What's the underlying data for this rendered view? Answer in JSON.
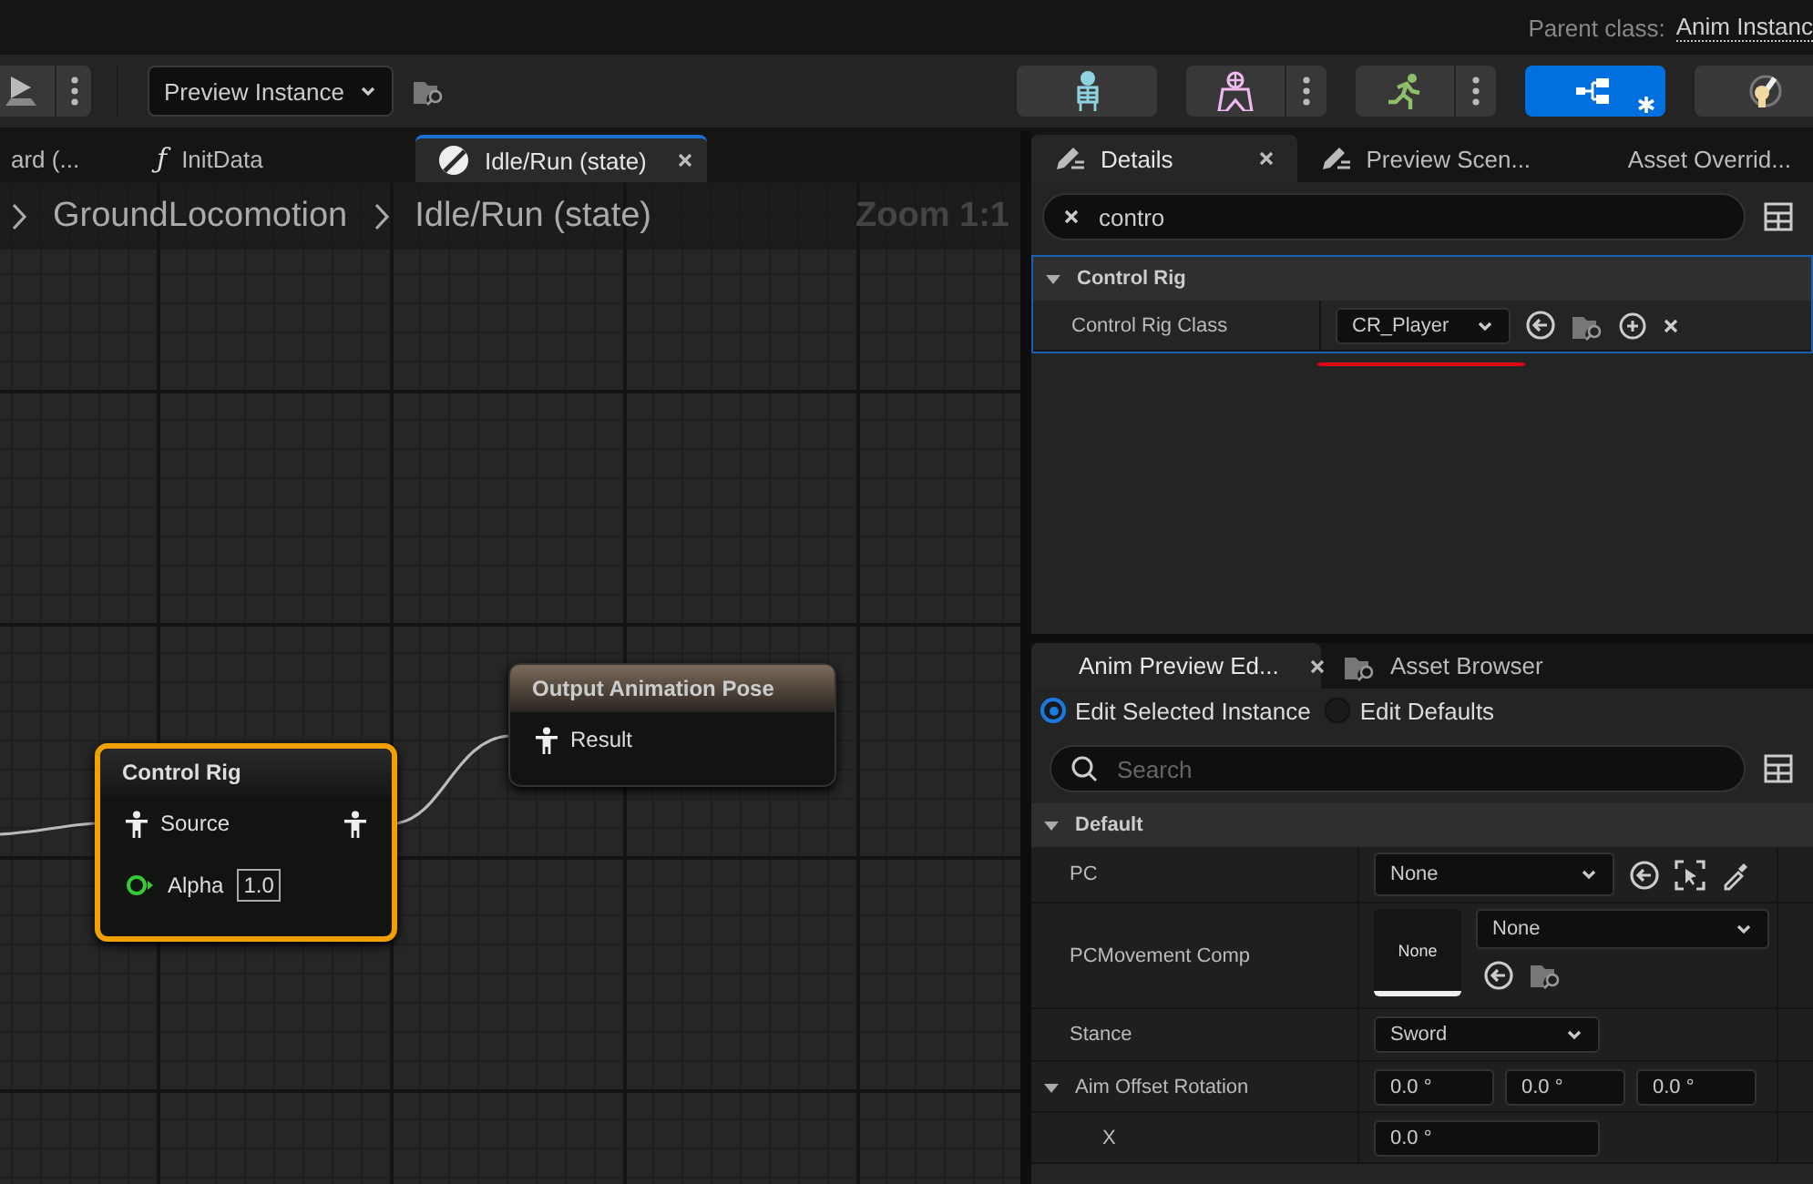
{
  "top_bar": {
    "parent_class_label": "Parent class:",
    "parent_class_value": "Anim Instanc"
  },
  "toolbar": {
    "preview_dropdown": "Preview Instance",
    "mode_buttons": [
      {
        "kind": "skeleton",
        "selected": false,
        "menu": false
      },
      {
        "kind": "mesh",
        "selected": false,
        "menu": true
      },
      {
        "kind": "animation",
        "selected": false,
        "menu": true
      },
      {
        "kind": "graph",
        "selected": true,
        "menu": false
      },
      {
        "kind": "blueprint",
        "selected": false,
        "menu": false
      }
    ]
  },
  "graph_tabs": [
    {
      "label": "ard (...",
      "kind": "plain",
      "selected": false,
      "closable": false
    },
    {
      "label": "InitData",
      "kind": "function",
      "glyph": "ƒ",
      "selected": false,
      "closable": false
    },
    {
      "label": "Idle/Run (state)",
      "kind": "state",
      "selected": true,
      "closable": true
    }
  ],
  "graph": {
    "breadcrumbs": [
      "GroundLocomotion",
      "Idle/Run (state)"
    ],
    "zoom": "Zoom 1:1",
    "nodes": [
      {
        "kind": "control_rig",
        "title": "Control Rig",
        "selected": true,
        "pins": [
          {
            "kind": "pose_in",
            "label": "Source"
          },
          {
            "kind": "pose_out"
          },
          {
            "kind": "float",
            "label": "Alpha",
            "value": "1.0"
          }
        ]
      },
      {
        "kind": "output",
        "title": "Output Animation Pose",
        "selected": false,
        "pins": [
          {
            "kind": "pose_in",
            "label": "Result"
          }
        ]
      }
    ]
  },
  "details_panel": {
    "tabs": [
      {
        "label": "Details",
        "kind": "details",
        "selected": true,
        "closable": true
      },
      {
        "label": "Preview Scen...",
        "kind": "details",
        "selected": false,
        "closable": false
      },
      {
        "label": "Asset Overrid...",
        "kind": "plain",
        "selected": false,
        "closable": false
      }
    ],
    "search": {
      "value": "contro"
    },
    "category": {
      "label": "Control Rig",
      "expanded": true
    },
    "rows": [
      {
        "label": "Control Rig Class",
        "value": "CR_Player",
        "underlined": true
      }
    ]
  },
  "preview_panel": {
    "tabs": [
      {
        "label": "Anim Preview Ed...",
        "kind": "plain",
        "selected": true,
        "closable": true
      },
      {
        "label": "Asset Browser",
        "kind": "folder",
        "selected": false,
        "closable": false
      }
    ],
    "radios": [
      {
        "label": "Edit Selected Instance",
        "selected": true
      },
      {
        "label": "Edit Defaults",
        "selected": false
      }
    ],
    "search": {
      "placeholder": "Search"
    },
    "category": {
      "label": "Default",
      "expanded": true
    },
    "rows": [
      {
        "kind": "object",
        "label": "PC",
        "value": "None"
      },
      {
        "kind": "asset",
        "label": "PCMovement Comp",
        "thumb": "None",
        "value": "None"
      },
      {
        "kind": "enum",
        "label": "Stance",
        "value": "Sword"
      },
      {
        "kind": "vector",
        "label": "Aim Offset Rotation",
        "expanded": true,
        "values": [
          "0.0 °",
          "0.0 °",
          "0.0 °"
        ],
        "children": [
          {
            "kind": "number",
            "label": "X",
            "value": "0.0 °"
          }
        ]
      }
    ]
  }
}
